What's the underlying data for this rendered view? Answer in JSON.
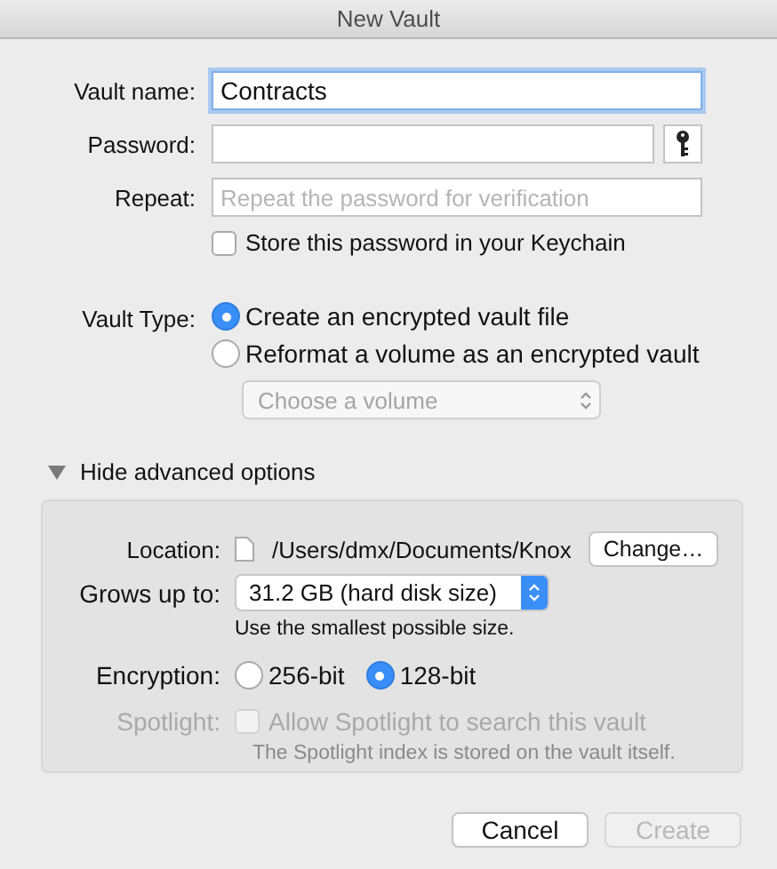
{
  "window": {
    "title": "New Vault"
  },
  "fields": [
    {
      "kind": "text",
      "label": "Vault name:",
      "value": "Contracts",
      "focused": true
    },
    {
      "kind": "password",
      "label": "Password:",
      "focused": false
    },
    {
      "kind": "text",
      "label": "Repeat:",
      "placeholder": "Repeat the password for verification",
      "focused": false
    }
  ],
  "keychain": {
    "label": "Store this password in your Keychain",
    "checked": false
  },
  "vault_type": {
    "label": "Vault Type:",
    "options": [
      {
        "label": "Create an encrypted vault file",
        "selected": true
      },
      {
        "label": "Reformat a volume as an encrypted vault",
        "selected": false
      }
    ],
    "volume_popup": {
      "value": "Choose a volume",
      "disabled": true
    }
  },
  "advanced": {
    "toggle": "Hide advanced options",
    "expanded": true,
    "location": {
      "label": "Location:",
      "path": "/Users/dmx/Documents/Knox",
      "button": "Change…"
    },
    "grows": {
      "label": "Grows up to:",
      "value": "31.2 GB (hard disk size)",
      "note": "Use the smallest possible size."
    },
    "encryption": {
      "label": "Encryption:",
      "options": [
        {
          "label": "256-bit",
          "selected": false
        },
        {
          "label": "128-bit",
          "selected": true
        }
      ]
    },
    "spotlight": {
      "label": "Spotlight:",
      "checkbox": "Allow Spotlight to search this vault",
      "checked": false,
      "disabled": true,
      "note": "The Spotlight index is stored on the vault itself."
    }
  },
  "buttons": [
    {
      "label": "Cancel",
      "disabled": false
    },
    {
      "label": "Create",
      "disabled": true
    }
  ]
}
